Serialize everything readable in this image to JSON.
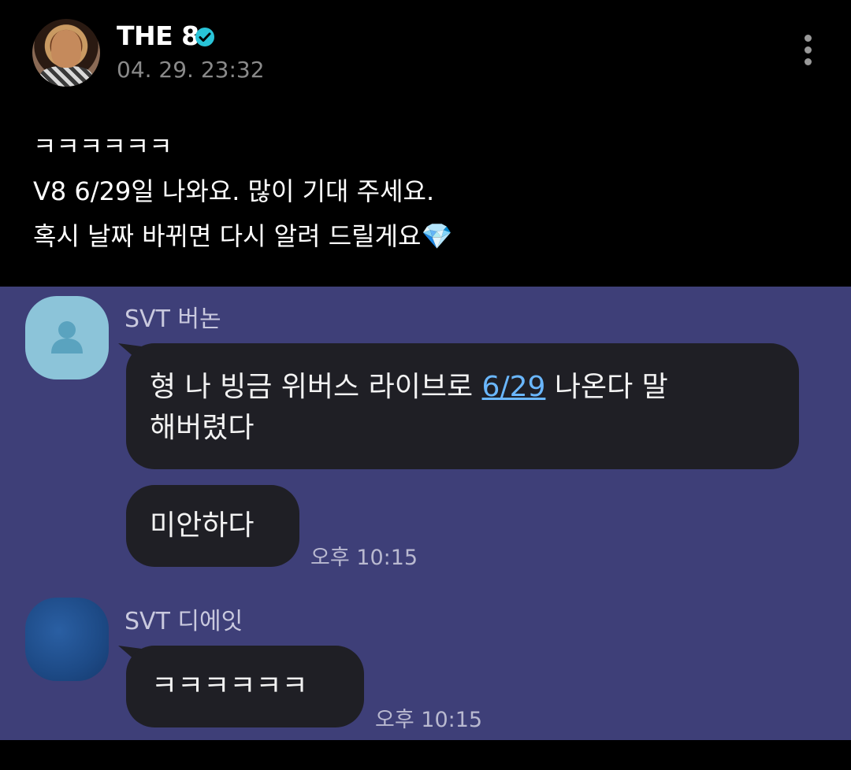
{
  "post": {
    "author": "THE 8",
    "timestamp": "04. 29. 23:32",
    "lines": [
      "ㅋㅋㅋㅋㅋㅋ",
      "V8 6/29일 나와요. 많이 기대 주세요.",
      "혹시 날짜 바뀌면 다시 알려 드릴게요💎"
    ]
  },
  "chat": {
    "messages": [
      {
        "sender": "SVT 버논",
        "bubble1_part1": "형 나 빙금 위버스 라이브로 ",
        "bubble1_link": "6/29",
        "bubble1_part2": " 나온다 말",
        "bubble1_line2": "해버렸다",
        "bubble2": "미안하다",
        "time": "오후 10:15"
      },
      {
        "sender": "SVT 디에잇",
        "bubble1": "ㅋㅋㅋㅋㅋㅋ",
        "time": "오후 10:15"
      }
    ]
  },
  "colors": {
    "chat_background": "#3e3f78",
    "bubble": "#1f1f25",
    "link": "#6ab7ff",
    "verified": "#29c4d8"
  },
  "icons": [
    "verified-badge-icon",
    "more-vertical-icon",
    "default-profile-icon"
  ]
}
